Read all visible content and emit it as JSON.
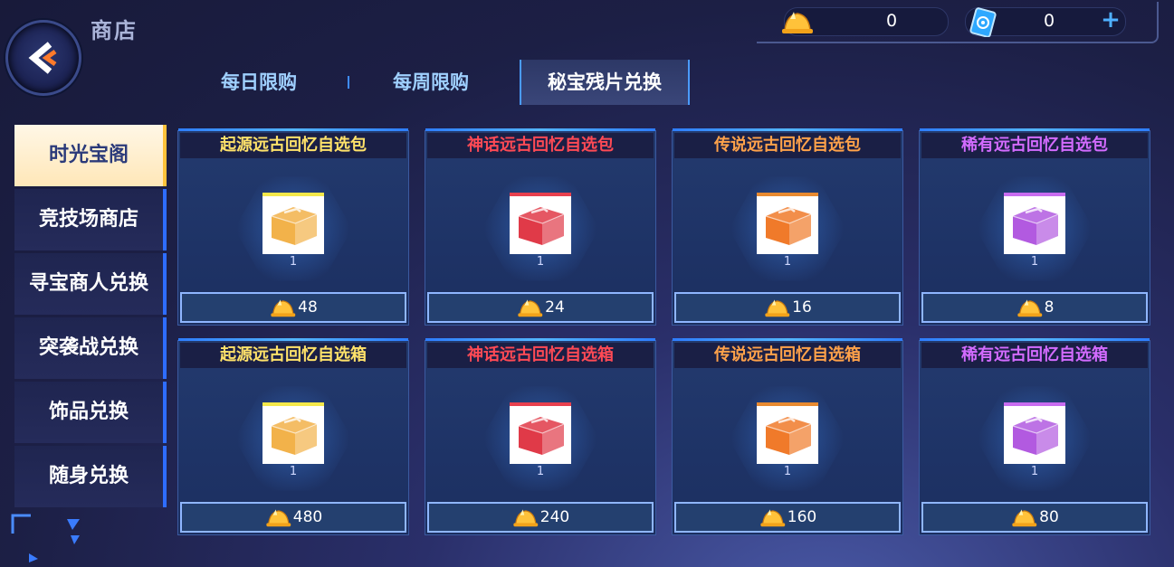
{
  "page_title": "商店",
  "currencies": [
    {
      "name": "bell-currency",
      "value": "0"
    },
    {
      "name": "ticket-currency",
      "value": "0"
    }
  ],
  "tabs": [
    {
      "label": "每日限购",
      "active": false
    },
    {
      "label": "每周限购",
      "active": false
    },
    {
      "label": "秘宝残片兑换",
      "active": true
    }
  ],
  "sidebar": [
    {
      "label": "时光宝阁",
      "active": true
    },
    {
      "label": "竞技场商店",
      "active": false
    },
    {
      "label": "寻宝商人兑换",
      "active": false
    },
    {
      "label": "突袭战兑换",
      "active": false
    },
    {
      "label": "饰品兑换",
      "active": false
    },
    {
      "label": "随身兑换",
      "active": false
    }
  ],
  "items": [
    {
      "title": "起源远古回忆自选包",
      "qty": "1",
      "price": "48",
      "title_color": "#ffe26a",
      "box_color": "#f2b24a",
      "top_color": "#f4e84a"
    },
    {
      "title": "神话远古回忆自选包",
      "qty": "1",
      "price": "24",
      "title_color": "#ff4a55",
      "box_color": "#e03a48",
      "top_color": "#e8404e"
    },
    {
      "title": "传说远古回忆自选包",
      "qty": "1",
      "price": "16",
      "title_color": "#ffa24a",
      "box_color": "#f07a2a",
      "top_color": "#e88a30"
    },
    {
      "title": "稀有远古回忆自选包",
      "qty": "1",
      "price": "8",
      "title_color": "#d36bff",
      "box_color": "#b25ae0",
      "top_color": "#c86cf0"
    },
    {
      "title": "起源远古回忆自选箱",
      "qty": "1",
      "price": "480",
      "title_color": "#ffe26a",
      "box_color": "#f2b24a",
      "top_color": "#f4e84a"
    },
    {
      "title": "神话远古回忆自选箱",
      "qty": "1",
      "price": "240",
      "title_color": "#ff4a55",
      "box_color": "#e03a48",
      "top_color": "#e8404e"
    },
    {
      "title": "传说远古回忆自选箱",
      "qty": "1",
      "price": "160",
      "title_color": "#ffa24a",
      "box_color": "#f07a2a",
      "top_color": "#e88a30"
    },
    {
      "title": "稀有远古回忆自选箱",
      "qty": "1",
      "price": "80",
      "title_color": "#d36bff",
      "box_color": "#b25ae0",
      "top_color": "#c86cf0"
    }
  ]
}
